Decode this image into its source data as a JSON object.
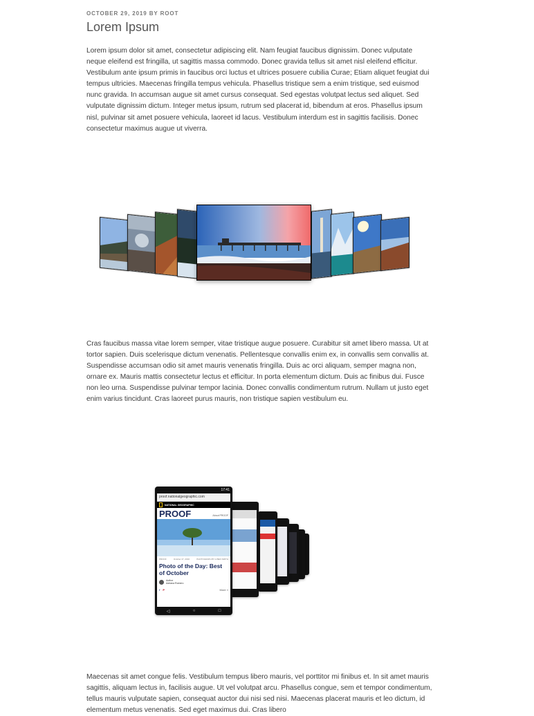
{
  "post": {
    "meta": "OCTOBER 29, 2019 BY ROOT",
    "title": "Lorem Ipsum",
    "paragraph1": "Lorem ipsum dolor sit amet, consectetur adipiscing elit. Nam feugiat faucibus dignissim. Donec vulputate neque eleifend est fringilla, ut sagittis massa commodo. Donec gravida tellus sit amet nisl eleifend efficitur. Vestibulum ante ipsum primis in faucibus orci luctus et ultrices posuere cubilia Curae; Etiam aliquet feugiat dui tempus ultricies. Maecenas fringilla tempus vehicula. Phasellus tristique sem a enim tristique, sed euismod nunc gravida. In accumsan augue sit amet cursus consequat. Sed egestas volutpat lectus sed aliquet. Sed vulputate dignissim dictum. Integer metus ipsum, rutrum sed placerat id, bibendum at eros. Phasellus ipsum nisl, pulvinar sit amet posuere vehicula, laoreet id lacus. Vestibulum interdum est in sagittis facilisis. Donec consectetur maximus augue ut viverra.",
    "paragraph2": "Cras faucibus massa vitae lorem semper, vitae tristique augue posuere. Curabitur sit amet libero massa. Ut at tortor sapien. Duis scelerisque dictum venenatis. Pellentesque convallis enim ex, in convallis sem convallis at. Suspendisse accumsan odio sit amet mauris venenatis fringilla. Duis ac orci aliquam, semper magna non, ornare ex. Mauris mattis consectetur lectus et efficitur. In porta elementum dictum. Duis ac finibus dui. Fusce non leo urna. Suspendisse pulvinar tempor lacinia. Donec convallis condimentum rutrum. Nullam ut justo eget enim varius tincidunt. Cras laoreet purus mauris, non tristique sapien vestibulum eu.",
    "paragraph3": "Maecenas sit amet congue felis. Vestibulum tempus libero mauris, vel porttitor mi finibus et. In sit amet mauris sagittis, aliquam lectus in, facilisis augue. Ut vel volutpat arcu. Phasellus congue, sem et tempor condimentum, tellus mauris vulputate sapien, consequat auctor dui nisi sed nisi. Maecenas placerat mauris et leo dictum, id elementum metus venenatis. Sed eget maximus dui. Cras libero"
  },
  "phone": {
    "url": "proof.nationalgeographic.com",
    "time": "17:41",
    "brand": "NATIONAL GEOGRAPHIC",
    "section": "PROOF",
    "about": "About PROOF",
    "kicker": "PROOF",
    "date": "October 27, 2016",
    "photo_credit": "PHOTOGRAPH BY A BEN SMITH",
    "headline": "Photo of the Day: Best of October",
    "author_label": "Author",
    "author_name": "Adriana Romero",
    "more": "More »"
  },
  "colors": {
    "meta": "#7a7a7a",
    "title": "#555555",
    "body_text": "#3c3c3c",
    "natgeo_yellow": "#f5c400",
    "proof_navy": "#1a2a5c"
  }
}
